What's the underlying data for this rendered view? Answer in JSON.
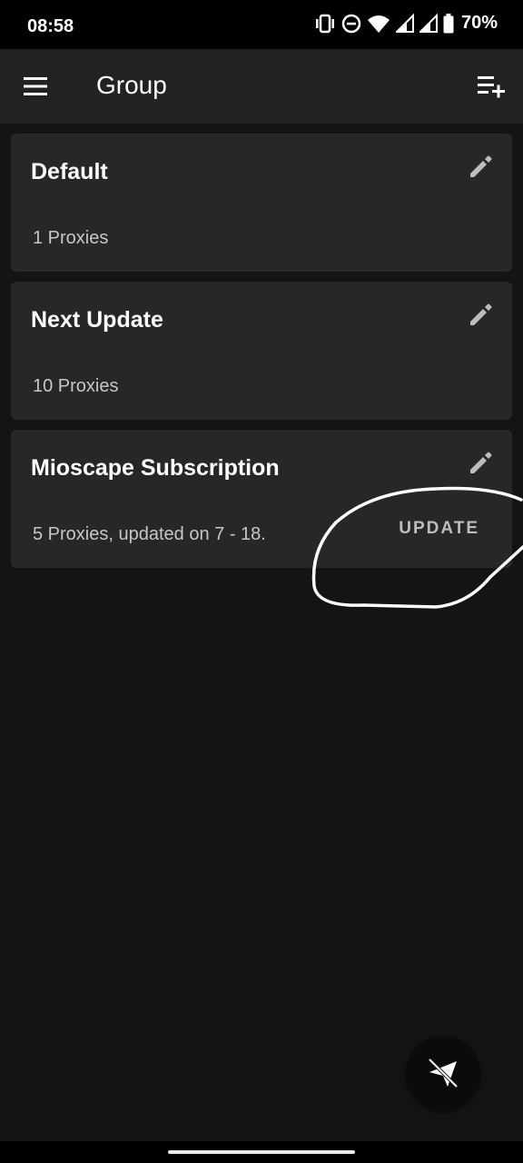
{
  "status_bar": {
    "time": "08:58",
    "battery": "70%",
    "icons": [
      "vibrate-icon",
      "dnd-icon",
      "wifi-icon",
      "signal-icon",
      "signal-icon",
      "battery-icon"
    ]
  },
  "app_bar": {
    "title": "Group",
    "menu_icon": "menu-icon",
    "add_icon": "playlist-add-icon"
  },
  "groups": [
    {
      "title": "Default",
      "subtitle": "1 Proxies"
    },
    {
      "title": "Next Update",
      "subtitle": "10 Proxies"
    },
    {
      "title": "Mioscape Subscription",
      "subtitle": "5 Proxies, updated on 7 - 18.",
      "action": "UPDATE"
    }
  ],
  "fab": {
    "icon": "send-off-icon"
  },
  "colors": {
    "background": "#141414",
    "card": "#272727",
    "app_bar": "#222222",
    "annotation": "#ffffff"
  }
}
